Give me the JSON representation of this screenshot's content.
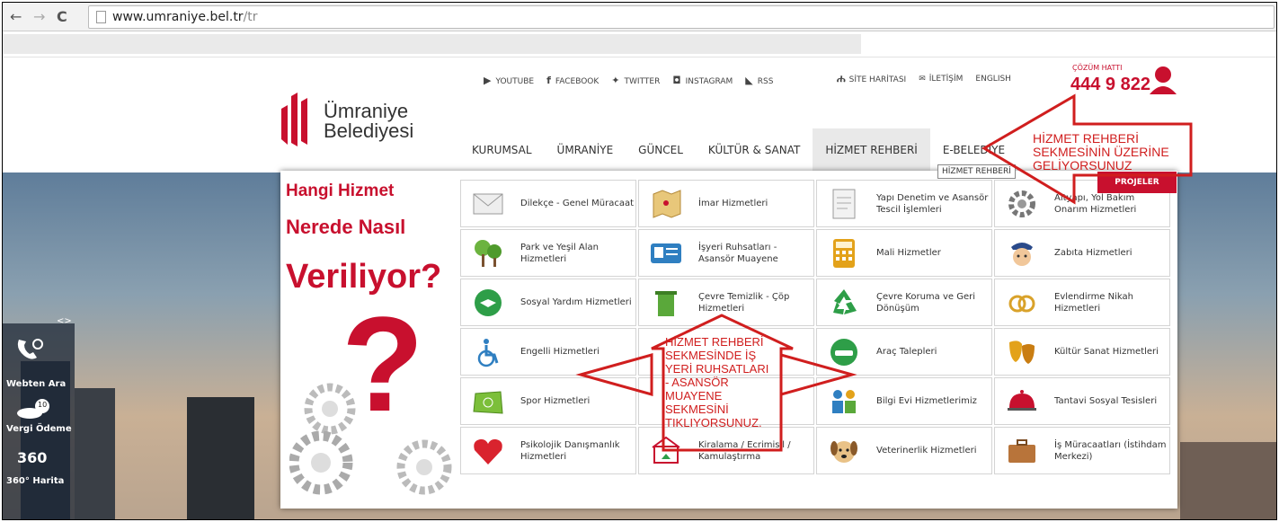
{
  "browser": {
    "back": "←",
    "forward": "→",
    "reload": "C",
    "url_host": "www.umraniye.bel.tr",
    "url_path": "/tr"
  },
  "header": {
    "logo_line1": "Ümraniye",
    "logo_line2": "Belediyesi",
    "social": [
      "YOUTUBE",
      "FACEBOOK",
      "TWITTER",
      "INSTAGRAM",
      "RSS"
    ],
    "util": [
      "SİTE HARİTASI",
      "İLETİŞİM",
      "ENGLISH"
    ],
    "hotline_label": "ÇÖZÜM HATTI",
    "hotline_number": "444 9 822",
    "brand_color": "#c8102e"
  },
  "nav": {
    "items": [
      "KURUMSAL",
      "ÜMRANİYE",
      "GÜNCEL",
      "KÜLTÜR & SANAT",
      "HİZMET REHBERİ",
      "E-BELEDİYE"
    ],
    "active": "HİZMET REHBERİ",
    "tooltip": "HİZMET REHBERİ",
    "projeler": "PROJELER"
  },
  "promo": {
    "line1": "Hangi Hizmet",
    "line2": "Nerede Nasıl",
    "line3": "Veriliyor?",
    "qmark": "?"
  },
  "services": [
    {
      "label": "Dilekçe - Genel Müracaat",
      "icon": "envelope-icon"
    },
    {
      "label": "İmar Hizmetleri",
      "icon": "map-icon"
    },
    {
      "label": "Yapı Denetim ve Asansör Tescil İşlemleri",
      "icon": "document-icon"
    },
    {
      "label": "Altyapı, Yol Bakım Onarım Hizmetleri",
      "icon": "gear-icon"
    },
    {
      "label": "Park ve Yeşil Alan Hizmetleri",
      "icon": "tree-icon"
    },
    {
      "label": "İşyeri Ruhsatları - Asansör Muayene",
      "icon": "id-card-icon"
    },
    {
      "label": "Mali Hizmetler",
      "icon": "calculator-icon"
    },
    {
      "label": "Zabıta Hizmetleri",
      "icon": "police-icon"
    },
    {
      "label": "Sosyal Yardım Hizmetleri",
      "icon": "handshake-icon"
    },
    {
      "label": "Çevre Temizlik - Çöp Hizmetleri",
      "icon": "trash-icon"
    },
    {
      "label": "Çevre Koruma ve Geri Dönüşüm",
      "icon": "recycle-icon"
    },
    {
      "label": "Evlendirme Nikah Hizmetleri",
      "icon": "rings-icon"
    },
    {
      "label": "Engelli Hizmetleri",
      "icon": "wheelchair-icon"
    },
    {
      "label": "",
      "icon": "blank-icon"
    },
    {
      "label": "Araç Talepleri",
      "icon": "car-icon"
    },
    {
      "label": "Kültür Sanat Hizmetleri",
      "icon": "masks-icon"
    },
    {
      "label": "Spor Hizmetleri",
      "icon": "field-icon"
    },
    {
      "label": "",
      "icon": "blank-icon"
    },
    {
      "label": "Bilgi Evi Hizmetlerimiz",
      "icon": "people-icon"
    },
    {
      "label": "Tantavi Sosyal Tesisleri",
      "icon": "cloche-icon"
    },
    {
      "label": "Psikolojik Danışmanlık Hizmetleri",
      "icon": "heart-icon"
    },
    {
      "label": "Kiralama / Ecrimisil / Kamulaştırma",
      "icon": "house-icon"
    },
    {
      "label": "Veterinerlik Hizmetleri",
      "icon": "dog-icon"
    },
    {
      "label": "İş Müracaatları (İstihdam Merkezi)",
      "icon": "briefcase-icon"
    }
  ],
  "widget": {
    "toggle": "<>",
    "items": [
      "Webten Ara",
      "Vergi Ödeme",
      "360° Harita"
    ],
    "badge": "10",
    "pano": "360"
  },
  "annotations": {
    "top": "HİZMET REHBERİ\nSEKMESİNİN ÜZERİNE\nGELİYORSUNUZ",
    "middle": "HİZMET REHBERİ\nSEKMESİNDE İŞ\nYERİ RUHSATLARI\n- ASANSÖR\nMUAYENE\nSEKMESİNİ\nTIKLIYORSUNUZ.",
    "color": "#d01e1e"
  }
}
